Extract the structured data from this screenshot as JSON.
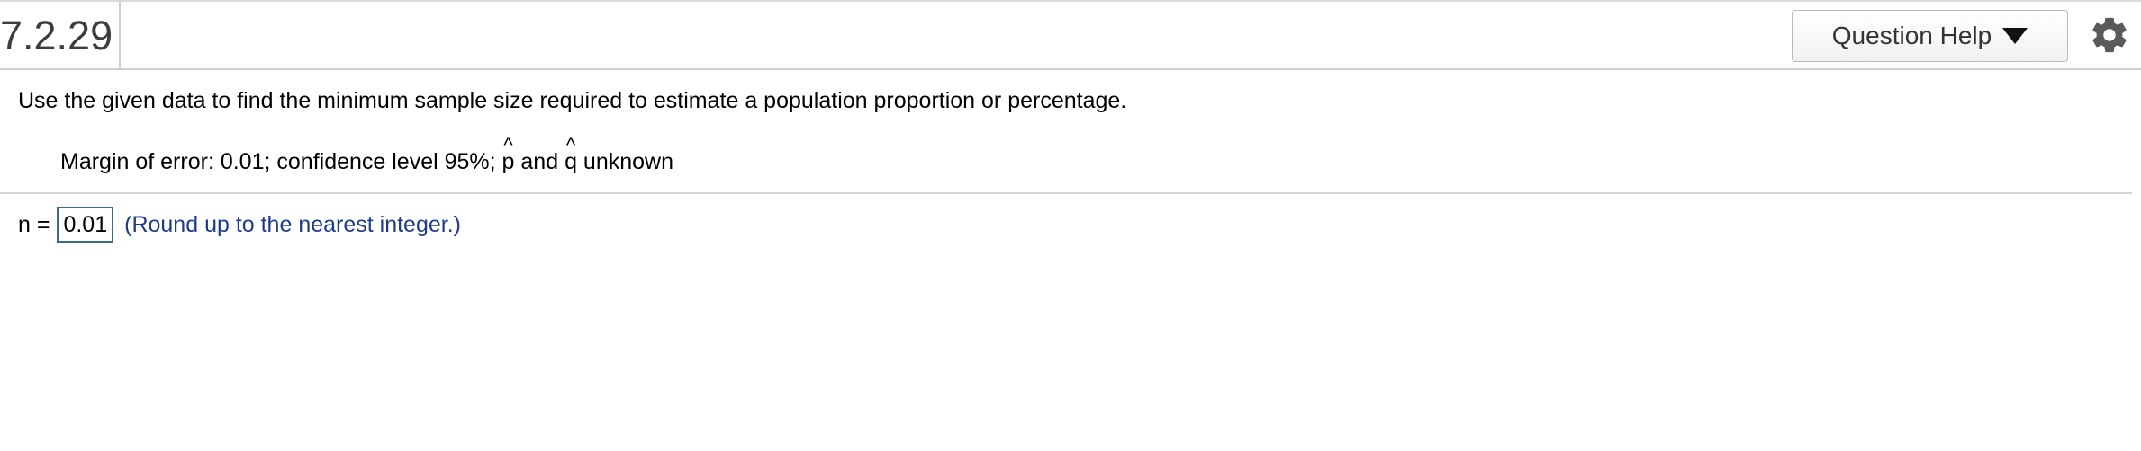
{
  "header": {
    "question_number": "7.2.29",
    "help_button_label": "Question Help"
  },
  "question": {
    "instruction": "Use the given data to find the minimum sample size required to estimate a population proportion or percentage.",
    "given_prefix": "Margin of error: 0.01; confidence level 95%; ",
    "p_symbol": "p",
    "and_text": " and ",
    "q_symbol": "q",
    "unknown_text": " unknown"
  },
  "answer": {
    "label": "n =",
    "value": "0.01",
    "hint": "(Round up to the nearest integer.)"
  },
  "icons": {
    "dropdown": "triangle-down-icon",
    "settings": "gear-icon"
  }
}
